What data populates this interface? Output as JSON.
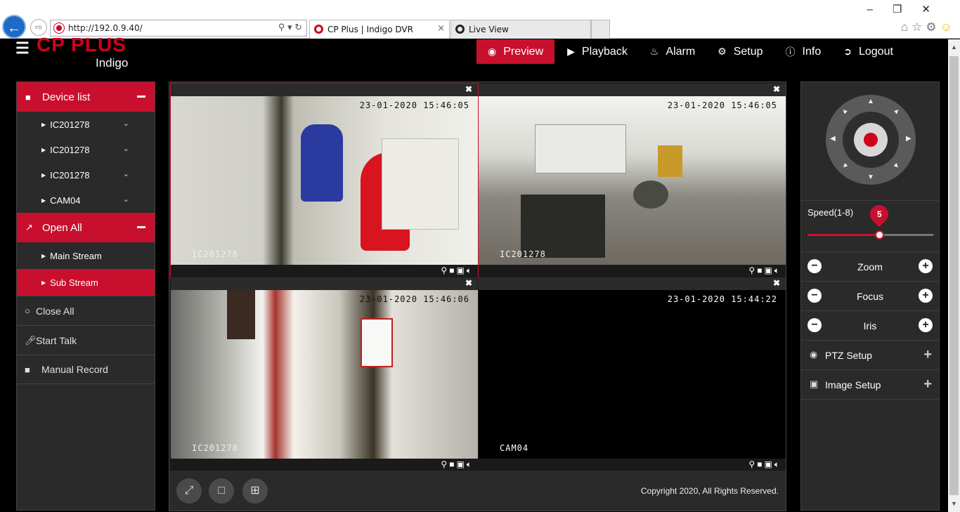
{
  "browser": {
    "url": "http://192.0.9.40/",
    "tabs": [
      {
        "title": "CP Plus | Indigo DVR"
      },
      {
        "title": "Live View"
      }
    ]
  },
  "header": {
    "brand": "CP PLUS",
    "subbrand": "Indigo",
    "nav": [
      {
        "label": "Preview",
        "icon": "eye-icon"
      },
      {
        "label": "Playback",
        "icon": "play-icon"
      },
      {
        "label": "Alarm",
        "icon": "bell-icon"
      },
      {
        "label": "Setup",
        "icon": "gear-icon"
      },
      {
        "label": "Info",
        "icon": "info-icon"
      },
      {
        "label": "Logout",
        "icon": "logout-icon"
      }
    ]
  },
  "left_panel": {
    "device_list_label": "Device list",
    "devices": [
      "IC201278",
      "IC201278",
      "IC201278",
      "CAM04"
    ],
    "open_all_label": "Open All",
    "streams": [
      "Main Stream",
      "Sub Stream"
    ],
    "selected_stream": "Sub Stream",
    "close_all_label": "Close All",
    "start_talk_label": "Start Talk",
    "manual_record_label": "Manual Record"
  },
  "video_grid": {
    "cells": [
      {
        "timestamp": "23-01-2020 15:46:05",
        "camera_name": "IC201278"
      },
      {
        "timestamp": "23-01-2020 15:46:05",
        "camera_name": "IC201278"
      },
      {
        "timestamp": "23-01-2020 15:46:06",
        "camera_name": "IC201278"
      },
      {
        "timestamp": "23-01-2020 15:44:22",
        "camera_name": "CAM04"
      }
    ],
    "copyright": "Copyright 2020, All Rights Reserved."
  },
  "right_panel": {
    "speed_label": "Speed(1-8)",
    "speed_value": "5",
    "speed_min": 1,
    "speed_max": 8,
    "zoom_label": "Zoom",
    "focus_label": "Focus",
    "iris_label": "Iris",
    "ptz_setup_label": "PTZ Setup",
    "image_setup_label": "Image Setup"
  },
  "colors": {
    "accent": "#c8102e",
    "panel": "#2a2a2a",
    "background": "#000000"
  }
}
